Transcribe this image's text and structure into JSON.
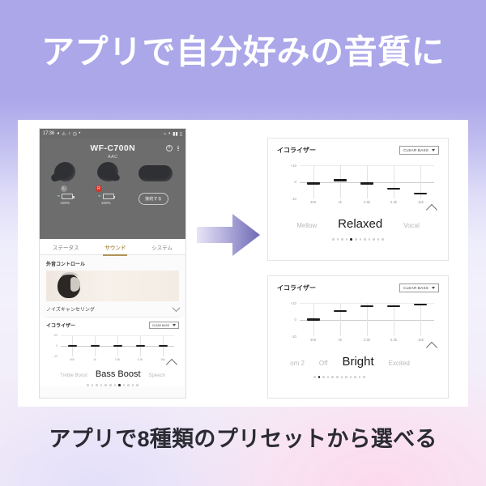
{
  "headline": "アプリで自分好みの音質に",
  "footline": "アプリで8種類のプリセットから選べる",
  "phone": {
    "statusbar": {
      "time": "17:36",
      "left_icons": [
        "clock-icon",
        "warning-icon",
        "music-icon",
        "timer-icon",
        "dot-icon"
      ],
      "right_icons": [
        "bluetooth-icon",
        "wifi-icon",
        "signal-icon",
        "battery-icon"
      ]
    },
    "device": {
      "name": "WF-C700N",
      "codec": "AAC",
      "power_icon": "power-icon",
      "menu_icon": "kebab-menu-icon"
    },
    "left_bud": {
      "badge": "L",
      "battery_percent": "100%",
      "bt_icon": "bluetooth-icon"
    },
    "right_bud": {
      "badge": "R",
      "battery_percent": "100%",
      "bt_icon": "bluetooth-icon"
    },
    "case_button": "接続する",
    "tabs": [
      {
        "label": "ステータス",
        "active": false
      },
      {
        "label": "サウンド",
        "active": true
      },
      {
        "label": "システム",
        "active": false
      }
    ],
    "ambient": {
      "title": "外音コントロール",
      "mode": "ノイズキャンセリング"
    },
    "equalizer": {
      "title": "イコライザー",
      "select": "CLEAR BASS",
      "preset_left": "Treble Boost",
      "preset_center": "Bass Boost",
      "preset_right": "Speech",
      "dots_total": 12,
      "dots_active_index": 7
    }
  },
  "panel_top": {
    "title": "イコライザー",
    "select": "CLEAR BASS",
    "preset_left": "Mellow",
    "preset_center": "Relaxed",
    "preset_right": "Vocal",
    "dots_total": 12,
    "dots_active_index": 4
  },
  "panel_bottom": {
    "title": "イコライザー",
    "select": "CLEAR BASS",
    "preset_far_left": "om 2",
    "preset_left": "Off",
    "preset_center": "Bright",
    "preset_right": "Excited",
    "dots_total": 12,
    "dots_active_index": 1
  },
  "colors": {
    "headline_text": "#ffffff",
    "footline_text": "#2b2b33",
    "bg_top": "#aba7e9",
    "bg_bottom": "#f3ecf7",
    "accent_tab": "#b09356",
    "card": "#ffffff",
    "arrow": "#8b87c9"
  },
  "chart_data": [
    {
      "type": "line",
      "name": "phone-equalizer-bass-boost",
      "title": "イコライザー",
      "categories": [
        "400",
        "1k",
        "2.5k",
        "6.3k",
        "16k"
      ],
      "values": [
        0,
        0,
        0,
        0,
        0
      ],
      "ylim": [
        -10,
        10
      ],
      "yticks": [
        "+10",
        "0",
        "-10"
      ],
      "ylabel": "",
      "xlabel": "",
      "grid": true
    },
    {
      "type": "line",
      "name": "panel-top-equalizer-relaxed",
      "title": "イコライザー",
      "categories": [
        "400",
        "1k",
        "2.5k",
        "6.3k",
        "16k"
      ],
      "values": [
        -1,
        1,
        -1,
        -4,
        -7
      ],
      "ylim": [
        -10,
        10
      ],
      "yticks": [
        "+10",
        "0",
        "-10"
      ],
      "ylabel": "",
      "xlabel": "",
      "grid": true
    },
    {
      "type": "line",
      "name": "panel-bottom-equalizer-bright",
      "title": "イコライザー",
      "categories": [
        "400",
        "1k",
        "2.5k",
        "6.3k",
        "16k"
      ],
      "values": [
        0,
        5,
        8,
        8,
        9
      ],
      "ylim": [
        -10,
        10
      ],
      "yticks": [
        "+10",
        "0",
        "-10"
      ],
      "ylabel": "",
      "xlabel": "",
      "grid": true
    }
  ]
}
